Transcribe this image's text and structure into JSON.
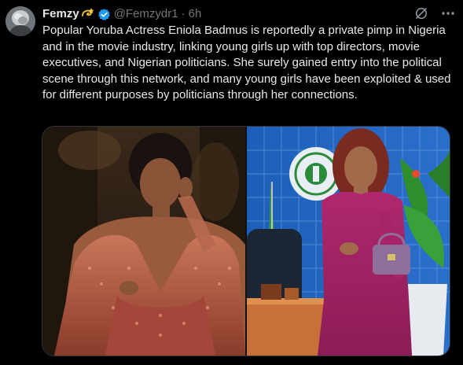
{
  "tweet": {
    "display_name": "Femzy",
    "handle": "@Femzydr1",
    "separator": "·",
    "timestamp": "6h",
    "text": "Popular Yoruba Actress Eniola Badmus is reportedly a private pimp in Nigeria and in the movie industry, linking young girls up with top directors, movie executives, and Nigerian politicians. She surely gained entry into the political scene through this network, and many young girls have been exploited & used for different purposes by politicians through her connections."
  },
  "icons": {
    "name_emoji": "dizzy-star-emoji",
    "verified": "verified-badge-icon",
    "grok": "grok-icon",
    "more": "more-options-icon"
  },
  "colors": {
    "background": "#000000",
    "text": "#e7e9ea",
    "muted": "#71767b",
    "verified": "#1d9bf0",
    "border": "#2f3336"
  },
  "media": {
    "count": 2
  }
}
